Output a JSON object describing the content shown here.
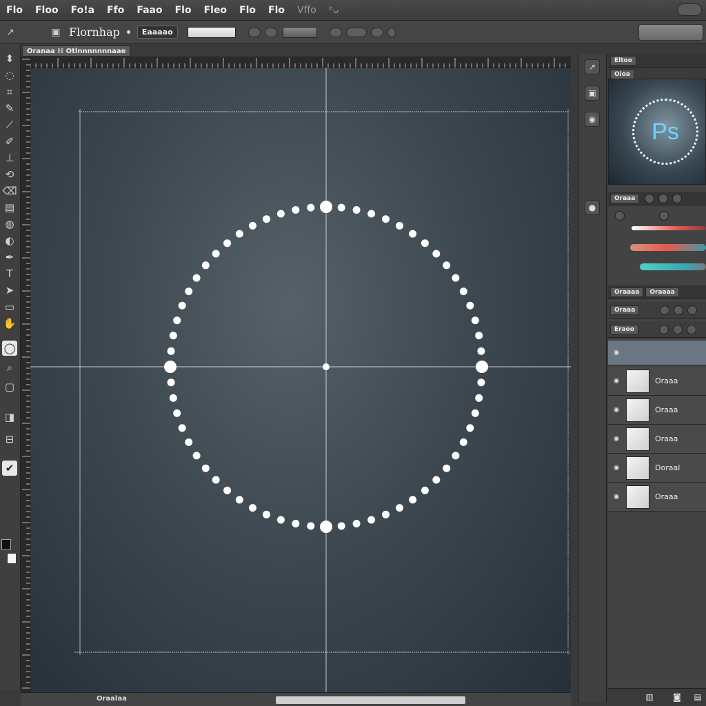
{
  "menu": {
    "items": [
      "Flo",
      "Floo",
      "Fo!a",
      "Ffo",
      "Faao",
      "Flo",
      "Fleo",
      "Flo",
      "Flo",
      "Vffo",
      "ᵇᴗ"
    ]
  },
  "options": {
    "app_name": "Flornhap",
    "field_label": "Eaaaao"
  },
  "document": {
    "tab_title": "Oranaa ℍ Otlnnnnnnnaae",
    "status_text": "Oraalaa"
  },
  "panels": {
    "top_tabs": [
      "Eltoo",
      "Oioa"
    ],
    "color_tabs": [
      "Oraaa"
    ],
    "layers_tabs": [
      "Oraaaa",
      "Oraaaa"
    ],
    "layers_toolbar_label": "Oraaa",
    "blend_label": "Eraoo",
    "logo_text": "Ps"
  },
  "layers": [
    {
      "name": "Oraaa"
    },
    {
      "name": "Oraaa"
    },
    {
      "name": "Oraaa"
    },
    {
      "name": "Doraal"
    },
    {
      "name": "Oraaa"
    }
  ],
  "slider_colors": [
    "#e85a50",
    "#4fd0c8"
  ],
  "icons": {
    "tools": [
      "move-tool-icon",
      "lasso-icon",
      "crop-icon",
      "brush-icon",
      "stamp-icon",
      "eraser-icon",
      "gradient-icon",
      "pen-icon",
      "type-icon",
      "shape-icon",
      "hand-icon",
      "zoom-icon"
    ]
  }
}
